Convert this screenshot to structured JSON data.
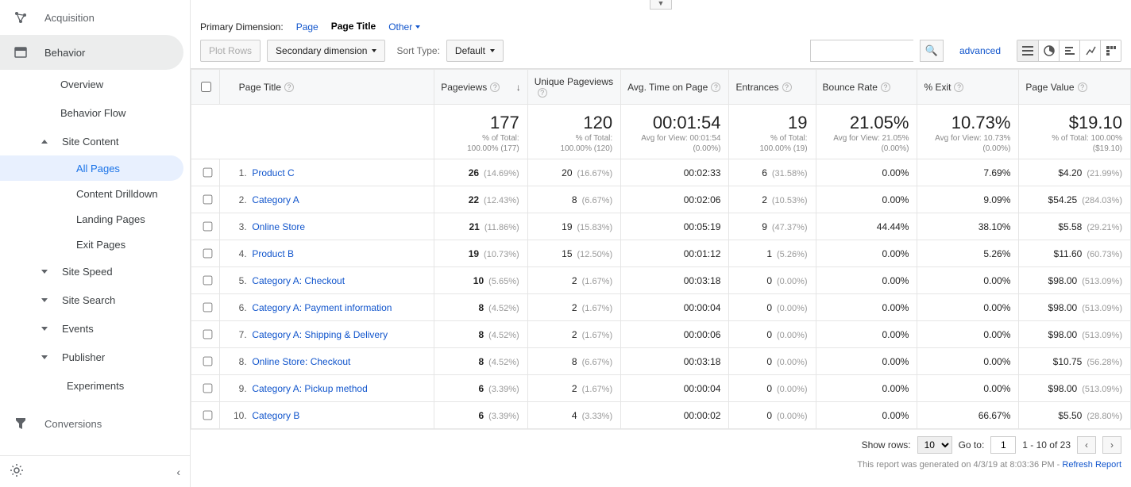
{
  "sidebar": {
    "acquisition": "Acquisition",
    "behavior": "Behavior",
    "overview": "Overview",
    "behavior_flow": "Behavior Flow",
    "site_content": "Site Content",
    "all_pages": "All Pages",
    "content_drilldown": "Content Drilldown",
    "landing_pages": "Landing Pages",
    "exit_pages": "Exit Pages",
    "site_speed": "Site Speed",
    "site_search": "Site Search",
    "events": "Events",
    "publisher": "Publisher",
    "experiments": "Experiments",
    "conversions": "Conversions"
  },
  "dims": {
    "label": "Primary Dimension:",
    "page": "Page",
    "page_title": "Page Title",
    "other": "Other"
  },
  "controls": {
    "plot_rows": "Plot Rows",
    "secondary": "Secondary dimension",
    "sort_label": "Sort Type:",
    "sort_value": "Default",
    "advanced": "advanced"
  },
  "headers": {
    "page_title": "Page Title",
    "pageviews": "Pageviews",
    "unique": "Unique Pageviews",
    "avg_time": "Avg. Time on Page",
    "entrances": "Entrances",
    "bounce": "Bounce Rate",
    "exit": "% Exit",
    "value": "Page Value"
  },
  "totals": {
    "pv": "177",
    "pv_sub1": "% of Total:",
    "pv_sub2": "100.00% (177)",
    "upv": "120",
    "upv_sub1": "% of Total:",
    "upv_sub2": "100.00% (120)",
    "time": "00:01:54",
    "time_sub1": "Avg for View: 00:01:54",
    "time_sub2": "(0.00%)",
    "ent": "19",
    "ent_sub1": "% of Total:",
    "ent_sub2": "100.00% (19)",
    "br": "21.05%",
    "br_sub1": "Avg for View: 21.05%",
    "br_sub2": "(0.00%)",
    "ex": "10.73%",
    "ex_sub1": "Avg for View: 10.73%",
    "ex_sub2": "(0.00%)",
    "val": "$19.10",
    "val_sub1": "% of Total: 100.00%",
    "val_sub2": "($19.10)"
  },
  "rows": [
    {
      "i": "1.",
      "title": "Product C",
      "pv": "26",
      "pvp": "(14.69%)",
      "upv": "20",
      "upvp": "(16.67%)",
      "time": "00:02:33",
      "ent": "6",
      "entp": "(31.58%)",
      "br": "0.00%",
      "ex": "7.69%",
      "val": "$4.20",
      "valp": "(21.99%)"
    },
    {
      "i": "2.",
      "title": "Category A",
      "pv": "22",
      "pvp": "(12.43%)",
      "upv": "8",
      "upvp": "(6.67%)",
      "time": "00:02:06",
      "ent": "2",
      "entp": "(10.53%)",
      "br": "0.00%",
      "ex": "9.09%",
      "val": "$54.25",
      "valp": "(284.03%)"
    },
    {
      "i": "3.",
      "title": "Online Store",
      "pv": "21",
      "pvp": "(11.86%)",
      "upv": "19",
      "upvp": "(15.83%)",
      "time": "00:05:19",
      "ent": "9",
      "entp": "(47.37%)",
      "br": "44.44%",
      "ex": "38.10%",
      "val": "$5.58",
      "valp": "(29.21%)"
    },
    {
      "i": "4.",
      "title": "Product B",
      "pv": "19",
      "pvp": "(10.73%)",
      "upv": "15",
      "upvp": "(12.50%)",
      "time": "00:01:12",
      "ent": "1",
      "entp": "(5.26%)",
      "br": "0.00%",
      "ex": "5.26%",
      "val": "$11.60",
      "valp": "(60.73%)"
    },
    {
      "i": "5.",
      "title": "Category A: Checkout",
      "pv": "10",
      "pvp": "(5.65%)",
      "upv": "2",
      "upvp": "(1.67%)",
      "time": "00:03:18",
      "ent": "0",
      "entp": "(0.00%)",
      "br": "0.00%",
      "ex": "0.00%",
      "val": "$98.00",
      "valp": "(513.09%)"
    },
    {
      "i": "6.",
      "title": "Category A: Payment information",
      "pv": "8",
      "pvp": "(4.52%)",
      "upv": "2",
      "upvp": "(1.67%)",
      "time": "00:00:04",
      "ent": "0",
      "entp": "(0.00%)",
      "br": "0.00%",
      "ex": "0.00%",
      "val": "$98.00",
      "valp": "(513.09%)"
    },
    {
      "i": "7.",
      "title": "Category A: Shipping & Delivery",
      "pv": "8",
      "pvp": "(4.52%)",
      "upv": "2",
      "upvp": "(1.67%)",
      "time": "00:00:06",
      "ent": "0",
      "entp": "(0.00%)",
      "br": "0.00%",
      "ex": "0.00%",
      "val": "$98.00",
      "valp": "(513.09%)"
    },
    {
      "i": "8.",
      "title": "Online Store: Checkout",
      "pv": "8",
      "pvp": "(4.52%)",
      "upv": "8",
      "upvp": "(6.67%)",
      "time": "00:03:18",
      "ent": "0",
      "entp": "(0.00%)",
      "br": "0.00%",
      "ex": "0.00%",
      "val": "$10.75",
      "valp": "(56.28%)"
    },
    {
      "i": "9.",
      "title": "Category A: Pickup method",
      "pv": "6",
      "pvp": "(3.39%)",
      "upv": "2",
      "upvp": "(1.67%)",
      "time": "00:00:04",
      "ent": "0",
      "entp": "(0.00%)",
      "br": "0.00%",
      "ex": "0.00%",
      "val": "$98.00",
      "valp": "(513.09%)"
    },
    {
      "i": "10.",
      "title": "Category B",
      "pv": "6",
      "pvp": "(3.39%)",
      "upv": "4",
      "upvp": "(3.33%)",
      "time": "00:00:02",
      "ent": "0",
      "entp": "(0.00%)",
      "br": "0.00%",
      "ex": "66.67%",
      "val": "$5.50",
      "valp": "(28.80%)"
    }
  ],
  "pager": {
    "show_rows": "Show rows:",
    "rows_value": "10",
    "goto": "Go to:",
    "goto_value": "1",
    "range": "1 - 10 of 23"
  },
  "gen": {
    "text": "This report was generated on 4/3/19 at 8:03:36 PM - ",
    "refresh": "Refresh Report"
  }
}
